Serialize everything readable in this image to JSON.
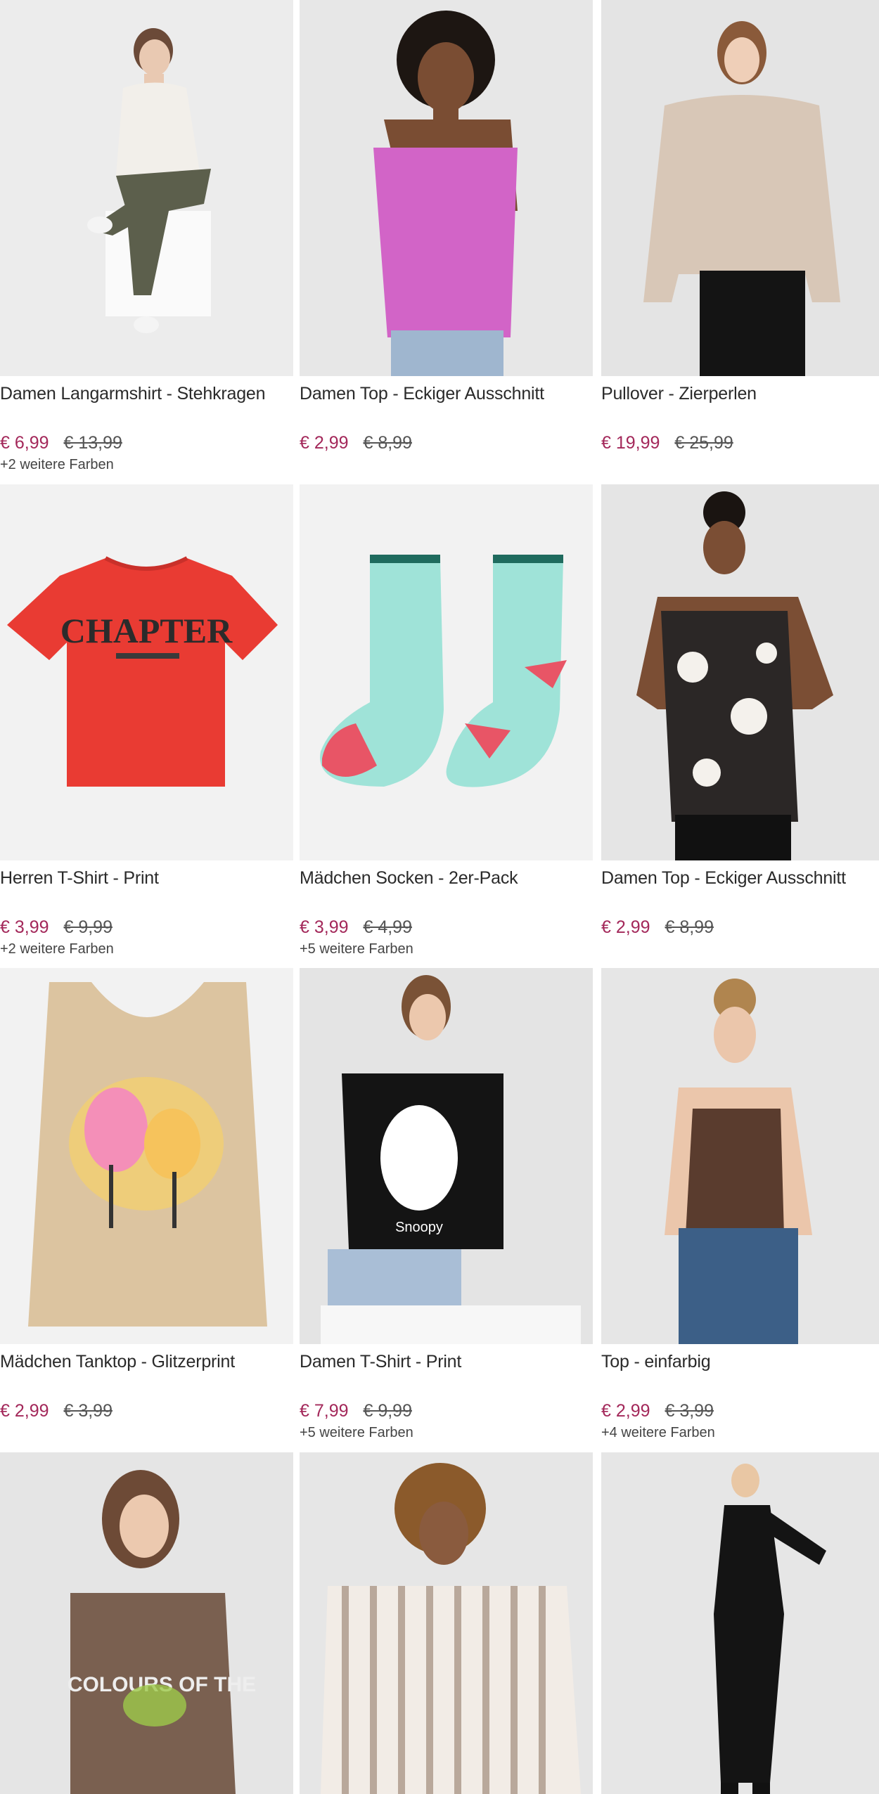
{
  "colors": {
    "accent": "#a3285a",
    "muted": "#555555",
    "background": "#ffffff"
  },
  "products": [
    {
      "name": "Damen Langarmshirt - Stehkragen",
      "price": "€ 6,99",
      "old_price": "€ 13,99",
      "more_colors": "+2 weitere Farben",
      "icon": "sitting-woman-image"
    },
    {
      "name": "Damen Top - Eckiger Ausschnitt",
      "price": "€ 2,99",
      "old_price": "€ 8,99",
      "more_colors": "",
      "icon": "pink-top-image"
    },
    {
      "name": "Pullover - Zierperlen",
      "price": "€ 19,99",
      "old_price": "€ 25,99",
      "more_colors": "",
      "icon": "knit-sweater-image"
    },
    {
      "name": "Herren T-Shirt - Print",
      "price": "€ 3,99",
      "old_price": "€ 9,99",
      "more_colors": "+2 weitere Farben",
      "icon": "red-tshirt-image",
      "print_text": "CHAPTER"
    },
    {
      "name": "Mädchen Socken - 2er-Pack",
      "price": "€ 3,99",
      "old_price": "€ 4,99",
      "more_colors": "+5 weitere Farben",
      "icon": "socks-image"
    },
    {
      "name": "Damen Top - Eckiger Ausschnitt",
      "price": "€ 2,99",
      "old_price": "€ 8,99",
      "more_colors": "",
      "icon": "floral-top-image"
    },
    {
      "name": "Mädchen Tanktop - Glitzerprint",
      "price": "€ 2,99",
      "old_price": "€ 3,99",
      "more_colors": "",
      "icon": "flamingo-tanktop-image"
    },
    {
      "name": "Damen T-Shirt - Print",
      "price": "€ 7,99",
      "old_price": "€ 9,99",
      "more_colors": "+5 weitere Farben",
      "icon": "snoopy-tshirt-image",
      "print_text": "Snoopy"
    },
    {
      "name": "Top - einfarbig",
      "price": "€ 2,99",
      "old_price": "€ 3,99",
      "more_colors": "+4 weitere Farben",
      "icon": "brown-top-image"
    },
    {
      "name": "",
      "price": "",
      "old_price": "",
      "more_colors": "",
      "icon": "colours-tshirt-image",
      "print_text": "COLOURS OF THE"
    },
    {
      "name": "",
      "price": "",
      "old_price": "",
      "more_colors": "",
      "icon": "striped-blouse-image"
    },
    {
      "name": "",
      "price": "",
      "old_price": "",
      "more_colors": "",
      "icon": "black-dress-image"
    }
  ]
}
